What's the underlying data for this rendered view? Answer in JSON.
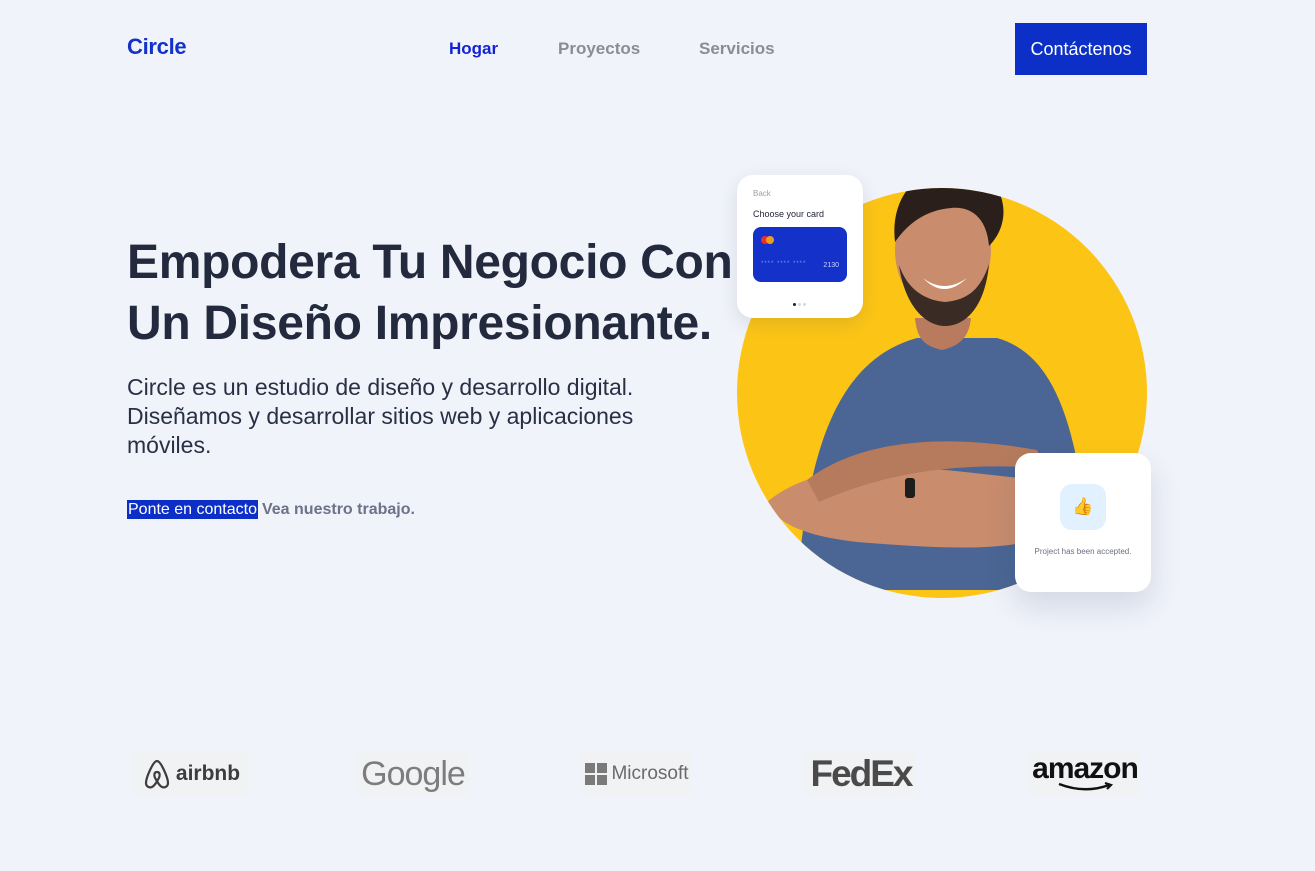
{
  "nav": {
    "logo": "Circle",
    "links": [
      "Hogar",
      "Proyectos",
      "Servicios"
    ],
    "cta": "Contáctenos"
  },
  "hero": {
    "title": "Empodera Tu Negocio Con Un Diseño Impresionante.",
    "subtitle": "Circle es un estudio de diseño y desarrollo digital. Diseñamos y desarrollar sitios web y aplicaciones móviles.",
    "link_contact": "Ponte en contacto",
    "link_work": "Vea nuestro trabajo."
  },
  "card_payment": {
    "back": "Back",
    "heading": "Choose your card",
    "masked": "**** **** ****",
    "card_last": "2130"
  },
  "card_accepted": {
    "icon": "thumbs-up-icon",
    "message": "Project has been accepted."
  },
  "brands": [
    "airbnb",
    "Google",
    "Microsoft",
    "FedEx",
    "amazon"
  ],
  "colors": {
    "accent": "#0b2fc7",
    "circle": "#fcc516",
    "background": "#f0f3fa"
  }
}
